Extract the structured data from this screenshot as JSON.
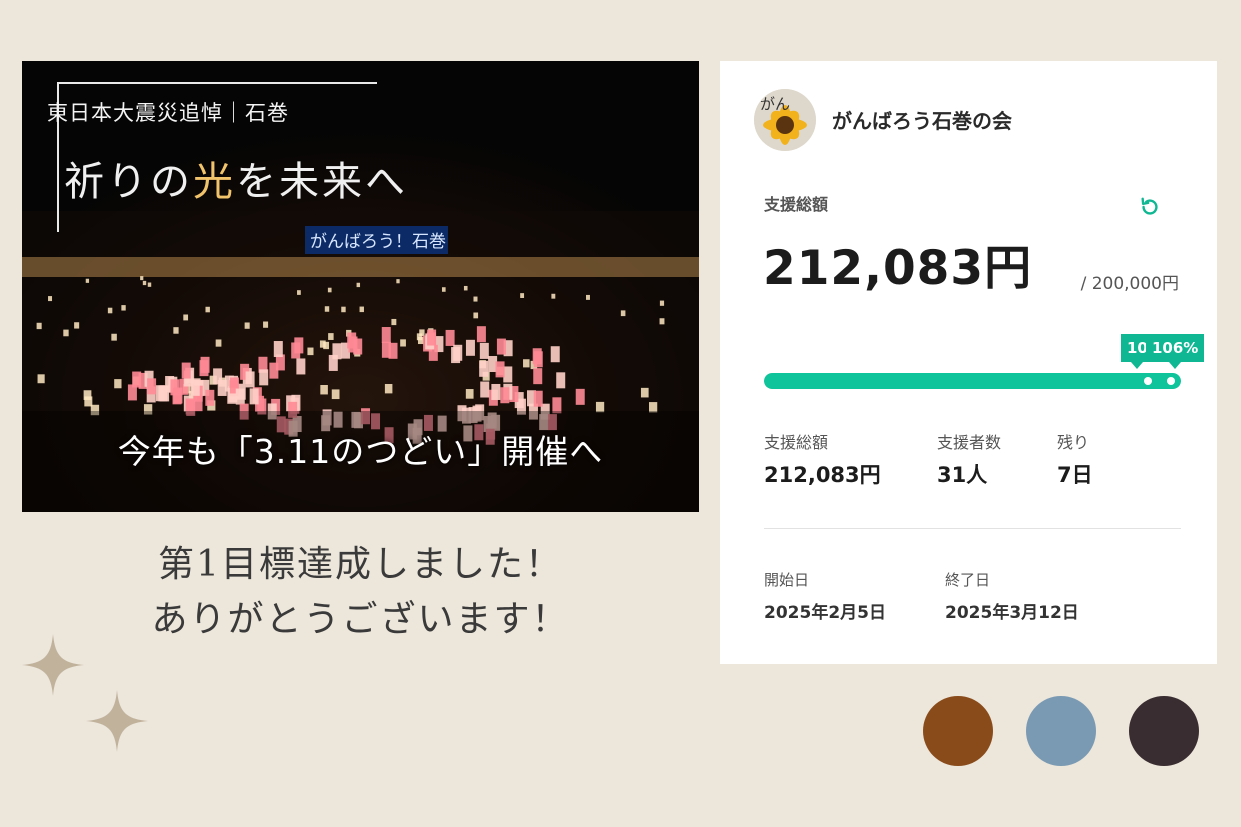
{
  "banner": {
    "kicker": "東日本大震災追悼｜石巻",
    "headline_before": "祈りの",
    "headline_accent": "光",
    "headline_after": "を未来へ",
    "sign_text": "がんばろう！石巻",
    "caption": "今年も「3.11のつどい」開催へ"
  },
  "thanks": {
    "line1": "第1目標達成しました！",
    "line2": "ありがとうございます！"
  },
  "card": {
    "organization": "がんばろう石巻の会",
    "avatar_text": "がん",
    "total_label": "支援総額",
    "total_amount": "212,083円",
    "goal": "/ 200,000円",
    "progress": {
      "fraction": 1.06,
      "tip_small": "10",
      "tip_percent": "106%"
    },
    "stats": [
      {
        "label": "支援総額",
        "value": "212,083円"
      },
      {
        "label": "支援者数",
        "value": "31人"
      },
      {
        "label": "残り",
        "value": "7日"
      }
    ],
    "dates": {
      "start_label": "開始日",
      "start_value": "2025年2月5日",
      "end_label": "終了日",
      "end_value": "2025年3月12日"
    },
    "accent_color": "#0fc49a"
  },
  "palette": [
    "#8a4b1a",
    "#7a9ab3",
    "#3a2d31"
  ]
}
